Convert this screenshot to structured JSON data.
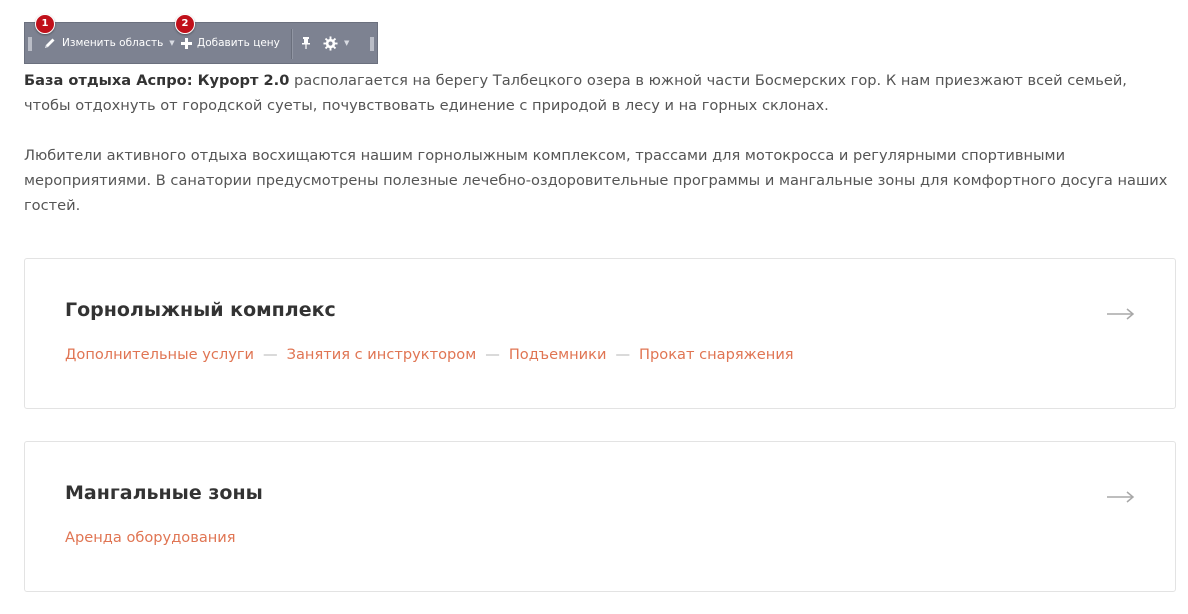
{
  "toolbar": {
    "edit_label": "Изменить область",
    "add_label": "Добавить цену",
    "badge_1": "1",
    "badge_2": "2",
    "bg_color": "#7d8291",
    "badge_color": "#c0101a",
    "icons": [
      "pencil-icon",
      "plus-icon",
      "pin-icon",
      "gear-icon",
      "chevron-down-icon"
    ]
  },
  "intro": {
    "p1_bold": "База отдыха Аспро: Курорт 2.0",
    "p1_rest": " располагается на берегу Талбецкого озера в южной части Босмерских гор. К нам приезжают всей семьей, чтобы отдохнуть от городской суеты, почувствовать единение с природой в лесу и на горных склонах.",
    "p2": "Любители активного отдыха восхищаются нашим горнолыжным комплексом, трассами для мотокросса и регулярными спортивными мероприятиями. В санатории предусмотрены полезные лечебно-оздоровительные программы и мангальные зоны для комфортного досуга наших гостей."
  },
  "cards": [
    {
      "title": "Горнолыжный комплекс",
      "separator": "—",
      "links": [
        "Дополнительные услуги",
        "Занятия с инструктором",
        "Подъемники",
        "Прокат снаряжения"
      ]
    },
    {
      "title": "Мангальные зоны",
      "links": [
        "Аренда оборудования"
      ]
    }
  ],
  "colors": {
    "link": "#e07553",
    "heading": "#333333",
    "text": "#555555",
    "card_border": "#e3e3e3"
  }
}
